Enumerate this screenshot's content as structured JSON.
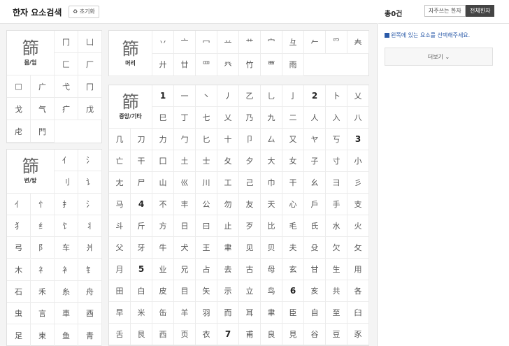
{
  "header": {
    "title": "한자 요소검색",
    "reset_label": "♻ 초기화"
  },
  "panels": {
    "body": {
      "glyph": "篩",
      "label": "몸/엄",
      "chars": [
        "冂",
        "凵",
        "匚",
        "厂",
        "□",
        "广",
        "弋",
        "冂",
        "戈",
        "气",
        "疒",
        "戊",
        "虍",
        "門"
      ]
    },
    "top": {
      "glyph": "篩",
      "label": "머리",
      "chars": [
        "丷",
        "亠",
        "冖",
        "䒑",
        "艹",
        "宀",
        "彑",
        "𠂉",
        "爫",
        "𡗗",
        "廾",
        "廿",
        "罒",
        "癶",
        "竹",
        "覀",
        "雨"
      ]
    },
    "side": {
      "glyph": "篩",
      "label": "변/방",
      "chars": [
        "亻",
        "氵",
        "刂",
        "讠",
        "亻",
        "忄",
        "扌",
        "氵",
        "犭",
        "纟",
        "饣",
        "丬",
        "弓",
        "阝",
        "车",
        "爿",
        "木",
        "礻",
        "衤",
        "钅",
        "石",
        "禾",
        "糸",
        "舟",
        "虫",
        "言",
        "車",
        "酉",
        "足",
        "束",
        "鱼",
        "青"
      ]
    },
    "middle": {
      "glyph": "篩",
      "label": "중앙/기타",
      "rows": [
        [
          "1",
          "一",
          "丶",
          "丿",
          "乙",
          "乚",
          "亅",
          "2",
          "卜",
          "乂"
        ],
        [
          "巳",
          "丁",
          "七",
          "乂",
          "乃",
          "九",
          "二",
          "人",
          "入",
          "八"
        ],
        [
          "几",
          "刀",
          "力",
          "勹",
          "匕",
          "十",
          "卩",
          "厶",
          "又",
          "ヤ",
          "丂",
          "3"
        ],
        [
          "亡",
          "干",
          "囗",
          "土",
          "士",
          "夂",
          "夕",
          "大",
          "女",
          "子",
          "寸",
          "小"
        ],
        [
          "尢",
          "尸",
          "山",
          "巛",
          "川",
          "工",
          "己",
          "巾",
          "干",
          "幺",
          "彐",
          "彡"
        ],
        [
          "马",
          "4",
          "不",
          "丰",
          "公",
          "勿",
          "友",
          "天",
          "心",
          "戶",
          "手",
          "支"
        ],
        [
          "斗",
          "斤",
          "方",
          "日",
          "曰",
          "止",
          "歹",
          "比",
          "毛",
          "氏",
          "水",
          "火"
        ],
        [
          "父",
          "牙",
          "牛",
          "犬",
          "王",
          "聿",
          "见",
          "贝",
          "夫",
          "殳",
          "欠",
          "攵"
        ],
        [
          "月",
          "5",
          "业",
          "兄",
          "占",
          "去",
          "古",
          "母",
          "玄",
          "甘",
          "生",
          "用"
        ],
        [
          "田",
          "白",
          "皮",
          "目",
          "矢",
          "示",
          "立",
          "鸟",
          "6",
          "亥",
          "共",
          "各"
        ],
        [
          "早",
          "米",
          "缶",
          "羊",
          "羽",
          "而",
          "耳",
          "聿",
          "臣",
          "自",
          "至",
          "臼"
        ],
        [
          "舌",
          "艮",
          "西",
          "页",
          "衣",
          "7",
          "甫",
          "良",
          "見",
          "谷",
          "豆",
          "豕"
        ]
      ]
    }
  },
  "right": {
    "count": "총0건",
    "toggle_frequent": "자주쓰는 한자",
    "toggle_all": "전체한자",
    "notice": "왼쪽에 있는 요소를 선택해주세요.",
    "more_label": "더보기 ⌄"
  },
  "colors": {
    "accent": "#1e5fd4",
    "active_toggle": "#444444"
  }
}
